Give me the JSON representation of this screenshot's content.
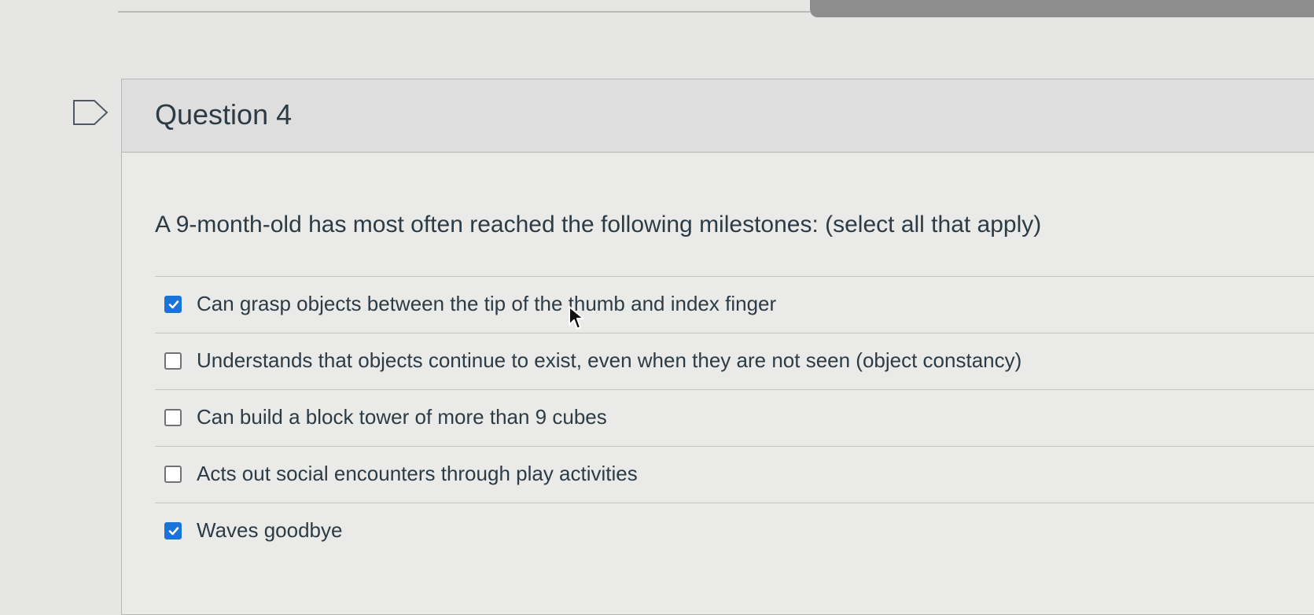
{
  "question": {
    "title": "Question 4",
    "prompt": "A 9-month-old has most often reached the following milestones: (select all that apply)",
    "answers": [
      {
        "label": "Can grasp objects between the tip of the thumb and index finger",
        "checked": true
      },
      {
        "label": "Understands that objects continue to exist, even when they are not seen (object constancy)",
        "checked": false
      },
      {
        "label": "Can build a block tower of more than 9 cubes",
        "checked": false
      },
      {
        "label": "Acts out social encounters through play activities",
        "checked": false
      },
      {
        "label": "Waves goodbye",
        "checked": true
      }
    ]
  },
  "icons": {
    "flag": "flag-icon",
    "checkbox_checked": "checkmark-icon",
    "cursor": "mouse-pointer-icon"
  },
  "colors": {
    "checked_box": "#1a73d9",
    "text": "#2d3b45"
  }
}
